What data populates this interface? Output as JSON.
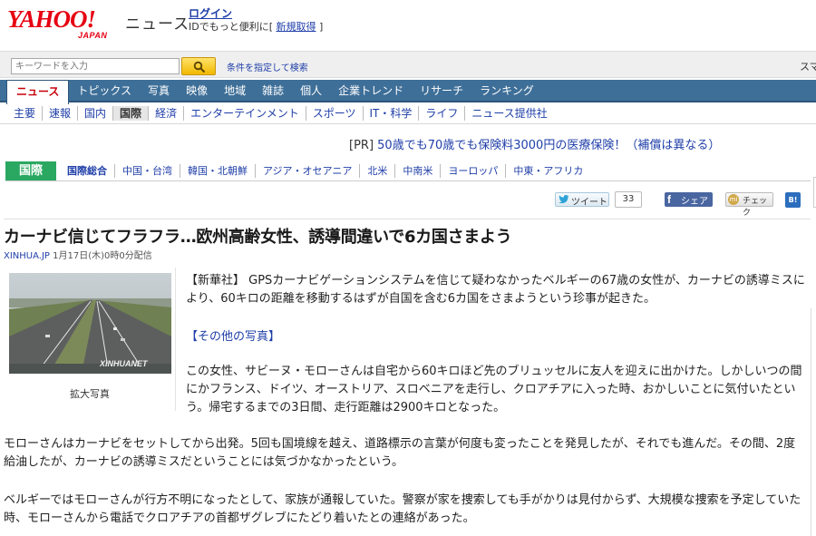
{
  "header": {
    "logo_text": "YAHOO!",
    "logo_sub": "JAPAN",
    "service": "ニュース",
    "login": "ログイン",
    "login_sub_prefix": "IDでもっと便利に[ ",
    "register": "新規取得",
    "login_sub_suffix": " ]"
  },
  "search": {
    "placeholder": "キーワードを入力",
    "detail_link": "条件を指定して検索",
    "right_text": "スマ"
  },
  "main_nav": [
    "ニュース",
    "トピックス",
    "写真",
    "映像",
    "地域",
    "雑誌",
    "個人",
    "企業トレンド",
    "リサーチ",
    "ランキング"
  ],
  "sub_nav": [
    "主要",
    "速報",
    "国内",
    "国際",
    "経済",
    "エンターテインメント",
    "スポーツ",
    "IT・科学",
    "ライフ",
    "ニュース提供社"
  ],
  "pr": {
    "tag": "[PR]",
    "text": " 50歳でも70歳でも保険料3000円の医療保険！（補償は異なる）"
  },
  "category": {
    "label": "国際",
    "items": [
      "国際総合",
      "中国・台湾",
      "韓国・北朝鮮",
      "アジア・オセアニア",
      "北米",
      "中南米",
      "ヨーロッパ",
      "中東・アフリカ"
    ]
  },
  "social": {
    "tweet": "ツイート",
    "tweet_count": "33",
    "share": "シェア",
    "check": "チェック",
    "hatena": "B!"
  },
  "article": {
    "title": "カーナビ信じてフラフラ…欧州高齢女性、誘導間違いで6カ国さまよう",
    "source": "XINHUA.JP",
    "date": " 1月17日(木)0時0分配信",
    "photo_watermark": "XINHUANET",
    "photo_caption": "拡大写真",
    "lead": "【新華社】 GPSカーナビゲーションシステムを信じて疑わなかったベルギーの67歳の女性が、カーナビの誘導ミスにより、60キロの距離を移動するはずが自国を含む6カ国をさまようという珍事が起きた。",
    "more_photos": "【その他の写真】",
    "para2": "この女性、サビーヌ・モローさんは自宅から60キロほど先のブリュッセルに友人を迎えに出かけた。しかしいつの間にかフランス、ドイツ、オーストリア、スロベニアを走行し、クロアチアに入った時、おかしいことに気付いたという。帰宅するまでの3日間、走行距離は2900キロとなった。",
    "para3": "モローさんはカーナビをセットしてから出発。5回も国境線を越え、道路標示の言葉が何度も変ったことを発見したが、それでも進んだ。その間、2度給油したが、カーナビの誘導ミスだということには気づかなかったという。",
    "para4": "ベルギーではモローさんが行方不明になったとして、家族が通報していた。警察が家を捜索しても手がかりは見付からず、大規模な捜索を予定していた時、モローさんから電話でクロアチアの首都ザグレブにたどり着いたとの連絡があった。"
  },
  "colors": {
    "brand_red": "#e60012",
    "nav_blue": "#3e6f98",
    "link_blue": "#1f3ea8",
    "category_green": "#2aa861"
  }
}
